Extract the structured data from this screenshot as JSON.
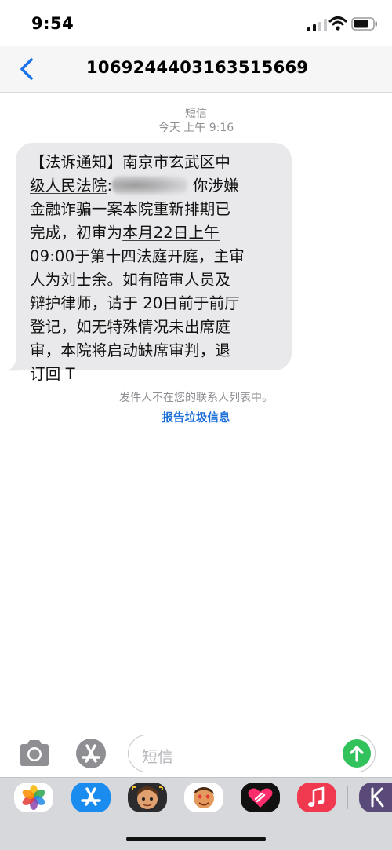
{
  "status_bar": {
    "time": "9:54"
  },
  "header": {
    "contact": "1069244403163515669"
  },
  "thread": {
    "type_label": "短信",
    "timestamp": "今天 上午 9:16"
  },
  "message": {
    "line1": "【法诉通知】",
    "line1_link": "南京市玄武区中",
    "line2_link": "级人民法院",
    "line2_colon": ":",
    "line2_rest": "你涉嫌",
    "line3": "金融诈骗一案本院重新排期已",
    "line4_a": "完成，初审为",
    "line4_link": "本月22日上午",
    "line5_link": "09:00",
    "line5_rest": "于第十四法庭开庭，主审",
    "line6": "人为刘士余。如有陪审人员及",
    "line7": "辩护律师，请于 20日前于前厅",
    "line8": "登记，如无特殊情况未出席庭",
    "line9": "审，本院将启动缺席审判，退",
    "line10": "订回 T"
  },
  "notice": {
    "text": "发件人不在您的联系人列表中。",
    "report": "报告垃圾信息"
  },
  "input": {
    "placeholder": "短信"
  },
  "colors": {
    "accent": "#1c6fd8",
    "send": "#31c25b",
    "bubble": "#e9e9eb"
  },
  "drawer_apps": [
    "photos-icon",
    "app-store-icon",
    "memoji-icon",
    "animoji-icon",
    "digital-touch-icon",
    "music-icon",
    "keyboard-app-icon"
  ]
}
